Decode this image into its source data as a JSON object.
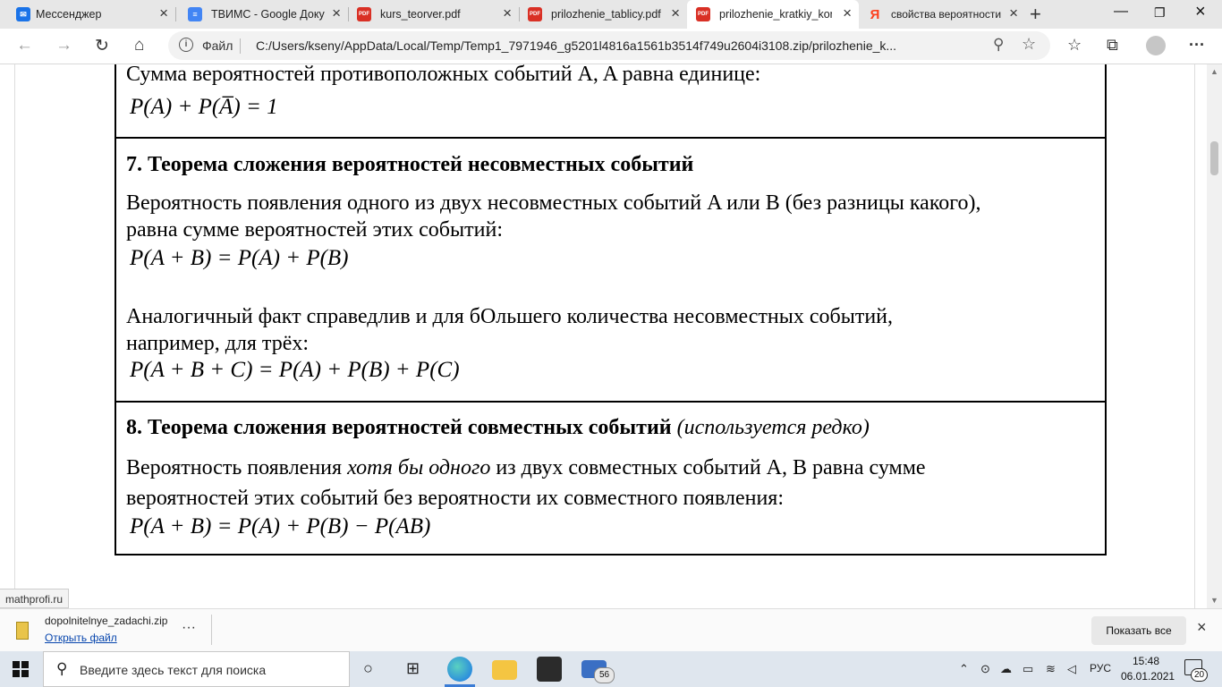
{
  "tabs": [
    {
      "title": "Мессенджер",
      "icon": "messenger-icon",
      "color": "#1a73e8"
    },
    {
      "title": "ТВИМС - Google Доку",
      "icon": "docs-icon",
      "color": "#4285f4"
    },
    {
      "title": "kurs_teorver.pdf",
      "icon": "pdf-icon",
      "color": "#d93025"
    },
    {
      "title": "prilozhenie_tablicy.pdf",
      "icon": "pdf-icon",
      "color": "#d93025"
    },
    {
      "title": "prilozhenie_kratkiy_kon",
      "icon": "pdf-icon",
      "color": "#d93025"
    },
    {
      "title": "свойства вероятности",
      "icon": "yandex-icon",
      "color": "#fc3f1d"
    }
  ],
  "address": {
    "file_label": "Файл",
    "url": "C:/Users/ksenу/AppData/Local/Temp/Temp1_7971946_g5201l4816a1561b3514f749u2604i3108.zip/prilozhenie_k..."
  },
  "doc": {
    "intro_text": "Сумма вероятностей противоположных событий  A, A  равна единице:",
    "intro_formula": "P(A) + P(A̅) = 1",
    "section7_heading": "7. Теорема сложения вероятностей несовместных событий",
    "section7_p1_line1": "Вероятность появления одного из двух несовместных событий  A  или  B  (без разницы какого),",
    "section7_p1_line2": "равна сумме вероятностей этих событий:",
    "section7_formula1": "P(A + B) = P(A) + P(B)",
    "section7_p2_line1": "Аналогичный факт справедлив и для бОльшего количества несовместных событий,",
    "section7_p2_line2": "например, для трёх:",
    "section7_formula2": "P(A + B + C) = P(A) + P(B) + P(C)",
    "section8_heading": "8. Теорема сложения вероятностей совместных событий",
    "section8_note": "(используется редко)",
    "section8_line1_a": "Вероятность появления ",
    "section8_line1_em": "хотя бы одного",
    "section8_line1_b": " из двух совместных событий  A, B  равна сумме",
    "section8_line2": "вероятностей этих событий без вероятности их совместного появления:",
    "section8_formula": "P(A + B) = P(A) + P(B) − P(AB)"
  },
  "status_url": "mathprofi.ru",
  "download": {
    "filename": "dopolnitelnye_zadachi.zip",
    "open_label": "Открыть файл",
    "more_label": "···",
    "show_all_label": "Показать все"
  },
  "taskbar": {
    "search_placeholder": "Введите здесь текст для поиска",
    "mail_badge": "56",
    "language": "РУС",
    "time": "15:48",
    "date": "06.01.2021",
    "notifications": "20"
  }
}
